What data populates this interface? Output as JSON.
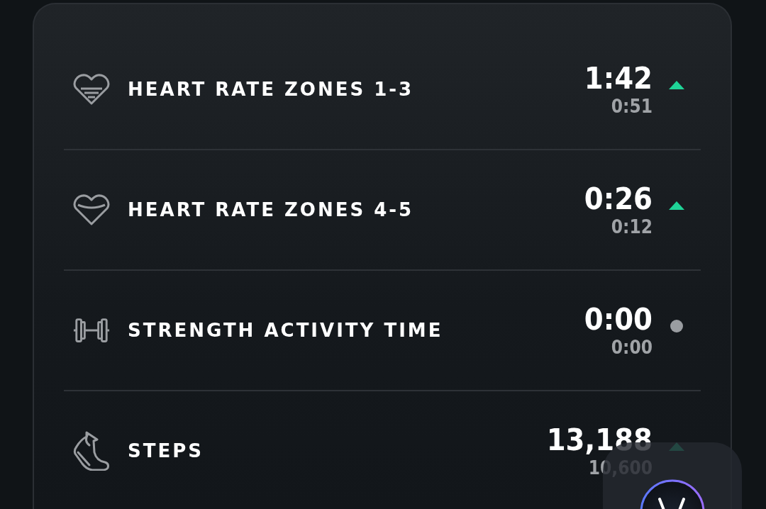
{
  "metrics": [
    {
      "kind": "heart-low",
      "label": "HEART RATE ZONES 1-3",
      "value": "1:42",
      "baseline": "0:51",
      "trend_up": true
    },
    {
      "kind": "heart-high",
      "label": "HEART RATE ZONES 4-5",
      "value": "0:26",
      "baseline": "0:12",
      "trend_up": true
    },
    {
      "kind": "dumbbell",
      "label": "STRENGTH ACTIVITY TIME",
      "value": "0:00",
      "baseline": "0:00",
      "trend_up": false
    },
    {
      "kind": "shoe",
      "label": "STEPS",
      "value": "13,188",
      "baseline": "10,600",
      "trend_up": true
    }
  ]
}
